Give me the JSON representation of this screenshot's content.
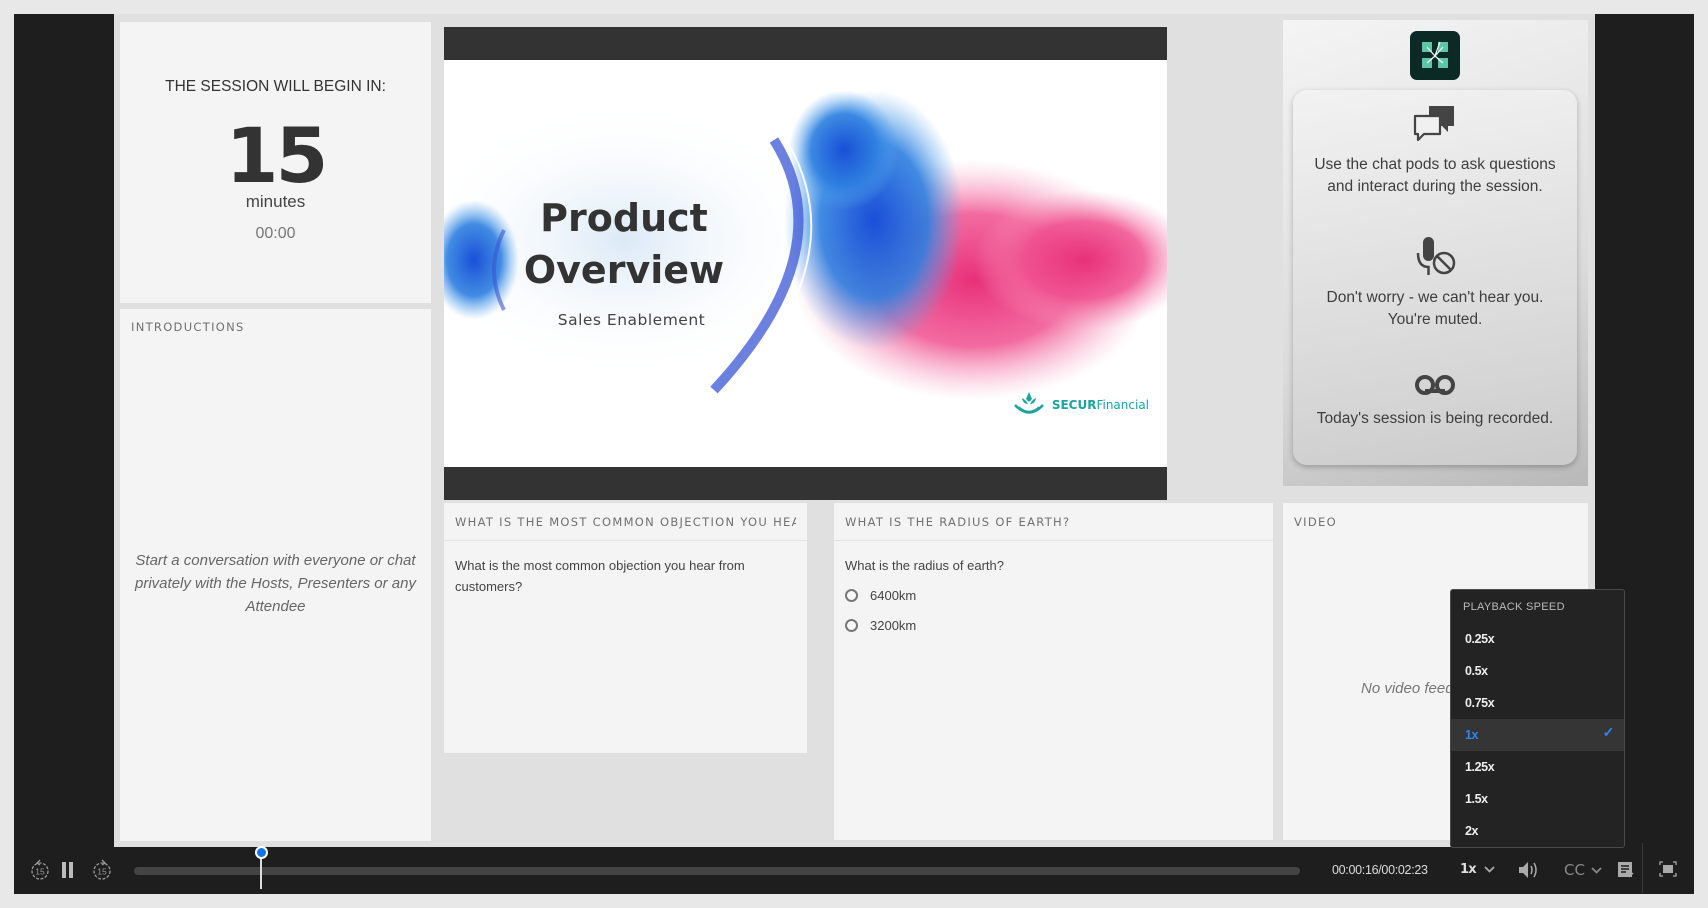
{
  "countdown": {
    "label": "THE SESSION WILL BEGIN IN:",
    "value": "15",
    "unit": "minutes",
    "clock": "00:00"
  },
  "introductions": {
    "title": "INTRODUCTIONS",
    "hint": "Start a conversation with everyone or chat privately with the Hosts, Presenters or any Attendee"
  },
  "slide": {
    "title_line1": "Product",
    "title_line2": "Overview",
    "subtitle": "Sales Enablement",
    "brand_bold": "SECUR",
    "brand_light": "Financial"
  },
  "info_panel": {
    "app_logo": "adobe-connect-logo",
    "items": [
      {
        "icon": "chat-bubbles-icon",
        "text": "Use the chat pods to ask questions and interact during the session."
      },
      {
        "icon": "microphone-muted-icon",
        "text": "Don't worry - we can't hear you. You're muted."
      },
      {
        "icon": "recording-icon",
        "text": "Today's session is being recorded."
      }
    ]
  },
  "question_pods": [
    {
      "title": "WHAT IS THE MOST COMMON OBJECTION YOU HEAR F...",
      "question": "What is the most common objection you hear from customers?"
    },
    {
      "title": "WHAT IS THE RADIUS OF EARTH?",
      "question": "What is the radius of earth?",
      "options": [
        "6400km",
        "3200km"
      ]
    }
  ],
  "video_pod": {
    "title": "VIDEO",
    "empty_text": "No video feed"
  },
  "playback_menu": {
    "title": "PLAYBACK SPEED",
    "options": [
      "0.25x",
      "0.5x",
      "0.75x",
      "1x",
      "1.25x",
      "1.5x",
      "2x"
    ],
    "selected": "1x"
  },
  "controls": {
    "rewind_label": "15",
    "forward_label": "15",
    "progress_fraction": 0.109,
    "time": "00:00:16/00:02:23",
    "speed": "1x",
    "cc": "CC"
  },
  "colors": {
    "accent": "#1473e6",
    "selected_text": "#2e86e8",
    "logo_bg": "#0c2a25",
    "logo_tile": "#5cc6a7",
    "brand_teal": "#1ba3a0"
  }
}
